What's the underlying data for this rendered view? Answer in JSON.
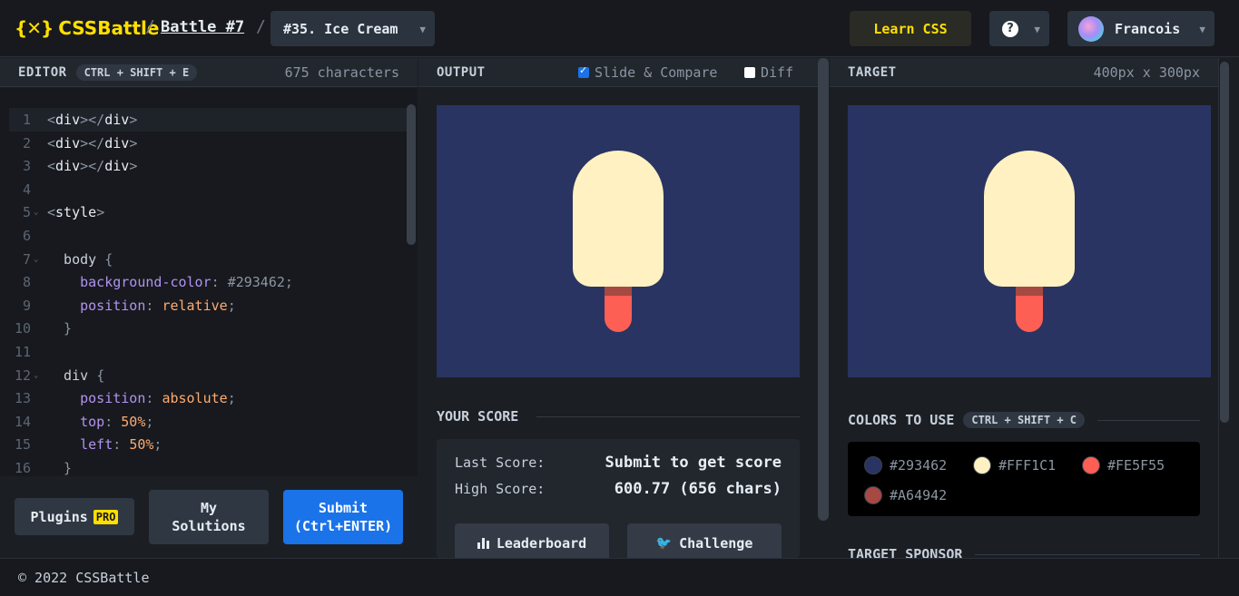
{
  "nav": {
    "logo_mark": "{✕}",
    "logo_text": "CSSBattle",
    "sep": "/",
    "battle": "Battle #7",
    "level": "#35. Ice Cream",
    "learn": "Learn CSS",
    "help": "?",
    "user": "Francois"
  },
  "editor": {
    "title": "EDITOR",
    "shortcut": "CTRL + SHIFT + E",
    "chars": "675 characters",
    "lines": [
      {
        "n": "1",
        "tokens": [
          [
            "t-tag",
            "<"
          ],
          [
            "t-name",
            "div"
          ],
          [
            "t-tag",
            "></"
          ],
          [
            "t-name",
            "div"
          ],
          [
            "t-tag",
            ">"
          ]
        ]
      },
      {
        "n": "2",
        "tokens": [
          [
            "t-tag",
            "<"
          ],
          [
            "t-name",
            "div"
          ],
          [
            "t-tag",
            "></"
          ],
          [
            "t-name",
            "div"
          ],
          [
            "t-tag",
            ">"
          ]
        ]
      },
      {
        "n": "3",
        "tokens": [
          [
            "t-tag",
            "<"
          ],
          [
            "t-name",
            "div"
          ],
          [
            "t-tag",
            "></"
          ],
          [
            "t-name",
            "div"
          ],
          [
            "t-tag",
            ">"
          ]
        ]
      },
      {
        "n": "4",
        "tokens": []
      },
      {
        "n": "5",
        "fold": true,
        "tokens": [
          [
            "t-tag",
            "<"
          ],
          [
            "t-name",
            "style"
          ],
          [
            "t-tag",
            ">"
          ]
        ]
      },
      {
        "n": "6",
        "tokens": []
      },
      {
        "n": "7",
        "fold": true,
        "tokens": [
          [
            "t-sel",
            "  body "
          ],
          [
            "t-punct",
            "{"
          ]
        ]
      },
      {
        "n": "8",
        "tokens": [
          [
            "t-sel",
            "    "
          ],
          [
            "t-prop",
            "background-color"
          ],
          [
            "t-punct",
            ": "
          ],
          [
            "t-hex",
            "#293462"
          ],
          [
            "t-punct",
            ";"
          ]
        ]
      },
      {
        "n": "9",
        "tokens": [
          [
            "t-sel",
            "    "
          ],
          [
            "t-prop",
            "position"
          ],
          [
            "t-punct",
            ": "
          ],
          [
            "t-val",
            "relative"
          ],
          [
            "t-punct",
            ";"
          ]
        ]
      },
      {
        "n": "10",
        "tokens": [
          [
            "t-punct",
            "  }"
          ]
        ]
      },
      {
        "n": "11",
        "tokens": []
      },
      {
        "n": "12",
        "fold": true,
        "tokens": [
          [
            "t-sel",
            "  div "
          ],
          [
            "t-punct",
            "{"
          ]
        ]
      },
      {
        "n": "13",
        "tokens": [
          [
            "t-sel",
            "    "
          ],
          [
            "t-prop",
            "position"
          ],
          [
            "t-punct",
            ": "
          ],
          [
            "t-val",
            "absolute"
          ],
          [
            "t-punct",
            ";"
          ]
        ]
      },
      {
        "n": "14",
        "tokens": [
          [
            "t-sel",
            "    "
          ],
          [
            "t-prop",
            "top"
          ],
          [
            "t-punct",
            ": "
          ],
          [
            "t-val",
            "50%"
          ],
          [
            "t-punct",
            ";"
          ]
        ]
      },
      {
        "n": "15",
        "tokens": [
          [
            "t-sel",
            "    "
          ],
          [
            "t-prop",
            "left"
          ],
          [
            "t-punct",
            ": "
          ],
          [
            "t-val",
            "50%"
          ],
          [
            "t-punct",
            ";"
          ]
        ]
      },
      {
        "n": "16",
        "tokens": [
          [
            "t-punct",
            "  }"
          ]
        ]
      }
    ],
    "plugins": "Plugins",
    "pro": "PRO",
    "solutions": "My\nSolutions",
    "submit": "Submit\n(Ctrl+ENTER)"
  },
  "output": {
    "title": "OUTPUT",
    "slide": "Slide & Compare",
    "slide_checked": true,
    "diff": "Diff",
    "diff_checked": false
  },
  "score": {
    "title": "YOUR SCORE",
    "last_label": "Last Score:",
    "last_value": "Submit to get score",
    "high_label": "High Score:",
    "high_value": "600.77 (656 chars)",
    "leaderboard": "Leaderboard",
    "challenge": "Challenge"
  },
  "target": {
    "title": "TARGET",
    "dims": "400px x 300px",
    "colors_title": "COLORS TO USE",
    "colors_shortcut": "CTRL + SHIFT + C",
    "colors": [
      "#293462",
      "#FFF1C1",
      "#FE5F55",
      "#A64942"
    ],
    "sponsor_title": "TARGET SPONSOR"
  },
  "palette": {
    "bg": "#293462",
    "cream": "#FFF1C1",
    "stick": "#FE5F55",
    "stick_dark": "#A64942"
  },
  "footer": {
    "copyright": "© 2022 CSSBattle"
  }
}
